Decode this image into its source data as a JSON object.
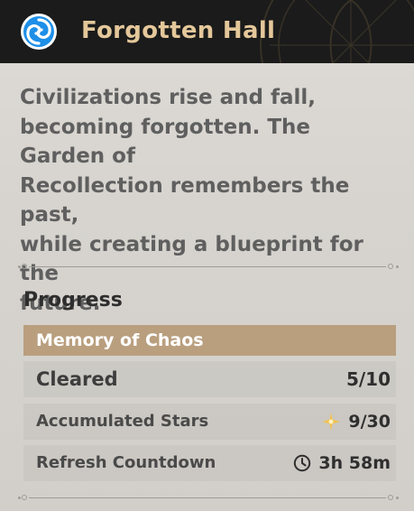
{
  "header": {
    "title": "Forgotten Hall",
    "icon": "memory-swirl-icon",
    "accent_color": "#e4c79a",
    "icon_color": "#1e8fe8"
  },
  "description": {
    "lines": [
      "Civilizations rise and fall,",
      "becoming forgotten. The Garden of",
      "Recollection remembers the past,",
      "while creating a blueprint for the",
      "future."
    ]
  },
  "progress": {
    "heading": "Progress",
    "mode": {
      "label": "Memory of Chaos",
      "color": "#b99f7e"
    },
    "cleared": {
      "label": "Cleared",
      "value": "5/10"
    },
    "stars": {
      "label": "Accumulated Stars",
      "value": "9/30",
      "icon": "star-icon",
      "icon_color": "#f2c14e"
    },
    "refresh": {
      "label": "Refresh Countdown",
      "value": "3h 58m",
      "icon": "clock-icon"
    }
  }
}
